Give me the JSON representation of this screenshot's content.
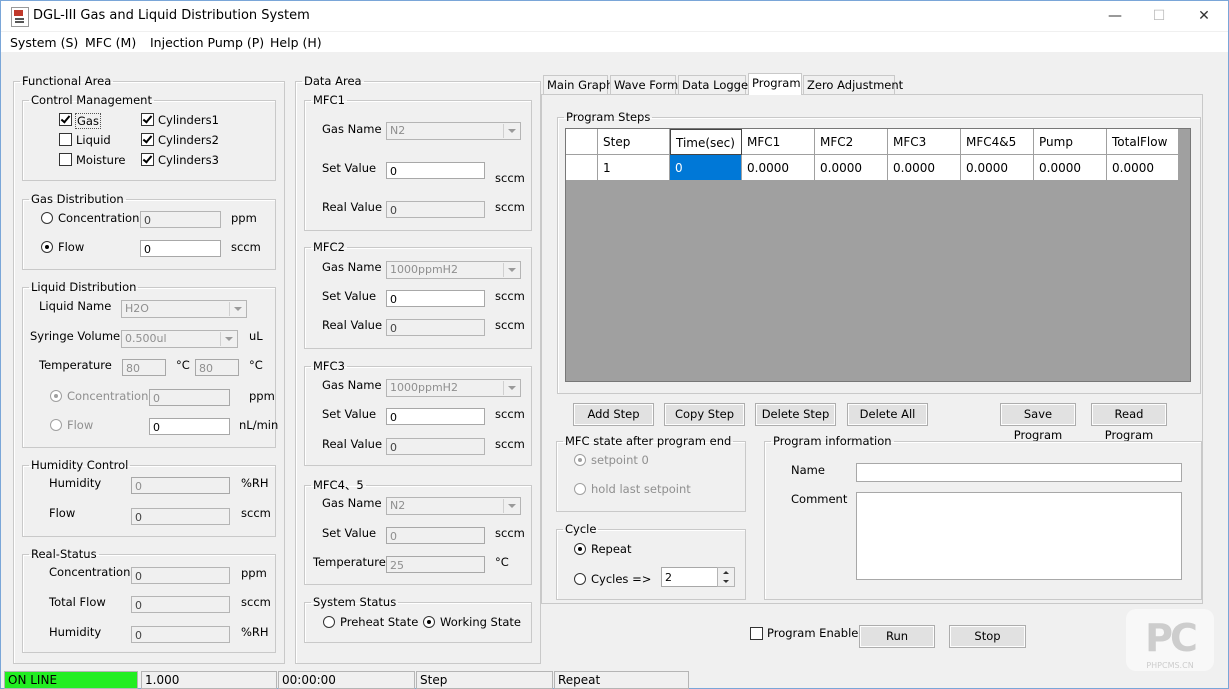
{
  "window": {
    "title": "DGL-III Gas and Liquid Distribution System",
    "minimize": "—",
    "maximize": "☐",
    "close": "✕"
  },
  "menu": [
    "System (S)",
    "MFC (M)",
    "Injection Pump (P)",
    "Help (H)"
  ],
  "functional": {
    "legend": "Functional Area",
    "control": {
      "legend": "Control Management",
      "gas": "Gas",
      "liquid": "Liquid",
      "moisture": "Moisture",
      "cyl1": "Cylinders1",
      "cyl2": "Cylinders2",
      "cyl3": "Cylinders3"
    },
    "gasdist": {
      "legend": "Gas Distribution",
      "conc_label": "Concentration",
      "conc_value": "0",
      "conc_unit": "ppm",
      "flow_label": "Flow",
      "flow_value": "0",
      "flow_unit": "sccm"
    },
    "liquid": {
      "legend": "Liquid Distribution",
      "name_label": "Liquid Name",
      "name_value": "H2O",
      "syringe_label": "Syringe Volume",
      "syringe_value": "0.500ul",
      "syringe_unit": "uL",
      "temp_label": "Temperature",
      "temp1": "80",
      "temp_unit1": "°C",
      "temp2": "80",
      "temp_unit2": "°C",
      "conc_label": "Concentration",
      "conc_value": "0",
      "conc_unit": "ppm",
      "flow_label": "Flow",
      "flow_value": "0",
      "flow_unit": "nL/min"
    },
    "humidity": {
      "legend": "Humidity Control",
      "hum_label": "Humidity",
      "hum_value": "0",
      "hum_unit": "%RH",
      "flow_label": "Flow",
      "flow_value": "0",
      "flow_unit": "sccm"
    },
    "real": {
      "legend": "Real-Status",
      "conc_label": "Concentration",
      "conc_value": "0",
      "conc_unit": "ppm",
      "total_label": "Total Flow",
      "total_value": "0",
      "total_unit": "sccm",
      "hum_label": "Humidity",
      "hum_value": "0",
      "hum_unit": "%RH"
    }
  },
  "data": {
    "legend": "Data Area",
    "mfc1": {
      "legend": "MFC1",
      "gas_label": "Gas Name",
      "gas_value": "N2",
      "set_label": "Set Value",
      "set_value": "0",
      "set_unit": "sccm",
      "real_label": "Real Value",
      "real_value": "0",
      "real_unit": "sccm"
    },
    "mfc2": {
      "legend": "MFC2",
      "gas_label": "Gas Name",
      "gas_value": "1000ppmH2",
      "set_label": "Set Value",
      "set_value": "0",
      "set_unit": "sccm",
      "real_label": "Real Value",
      "real_value": "0",
      "real_unit": "sccm"
    },
    "mfc3": {
      "legend": "MFC3",
      "gas_label": "Gas Name",
      "gas_value": "1000ppmH2",
      "set_label": "Set Value",
      "set_value": "0",
      "set_unit": "sccm",
      "real_label": "Real Value",
      "real_value": "0",
      "real_unit": "sccm"
    },
    "mfc45": {
      "legend": "MFC4、5",
      "gas_label": "Gas Name",
      "gas_value": "N2",
      "set_label": "Set Value",
      "set_value": "0",
      "set_unit": "sccm",
      "temp_label": "Temperature",
      "temp_value": "25",
      "temp_unit": "°C"
    },
    "system": {
      "legend": "System Status",
      "preheat": "Preheat State",
      "working": "Working State"
    }
  },
  "tabs": [
    "Main Graph",
    "Wave Form",
    "Data Logger",
    "Program",
    "Zero Adjustment"
  ],
  "program": {
    "steps_legend": "Program Steps",
    "columns": [
      "Step",
      "Time(sec)",
      "MFC1",
      "MFC2",
      "MFC3",
      "MFC4&5",
      "Pump",
      "TotalFlow"
    ],
    "rows": [
      [
        "1",
        "0",
        "0.0000",
        "0.0000",
        "0.0000",
        "0.0000",
        "0.0000",
        "0.0000"
      ]
    ],
    "buttons": {
      "add": "Add Step",
      "copy": "Copy Step",
      "delete": "Delete Step",
      "delete_all": "Delete All",
      "save": "Save Program",
      "read": "Read Program"
    },
    "mfc_state": {
      "legend": "MFC state after program end",
      "opt1": "setpoint 0",
      "opt2": "hold last setpoint"
    },
    "cycle": {
      "legend": "Cycle",
      "repeat": "Repeat",
      "cycles": "Cycles =>",
      "cycles_value": "2"
    },
    "info": {
      "legend": "Program information",
      "name_label": "Name",
      "name_value": "",
      "comment_label": "Comment",
      "comment_value": ""
    },
    "enable_label": "Program Enable",
    "run": "Run",
    "stop": "Stop"
  },
  "statusbar": [
    "ON LINE",
    "1.000",
    "00:00:00",
    "Step",
    "Repeat"
  ],
  "watermark": {
    "logo": "PC",
    "text": "PHPCMS.CN"
  },
  "colors": {
    "online": "#22ee22",
    "selected_cell": "#0078d7",
    "grid_bg": "#a0a0a0"
  }
}
